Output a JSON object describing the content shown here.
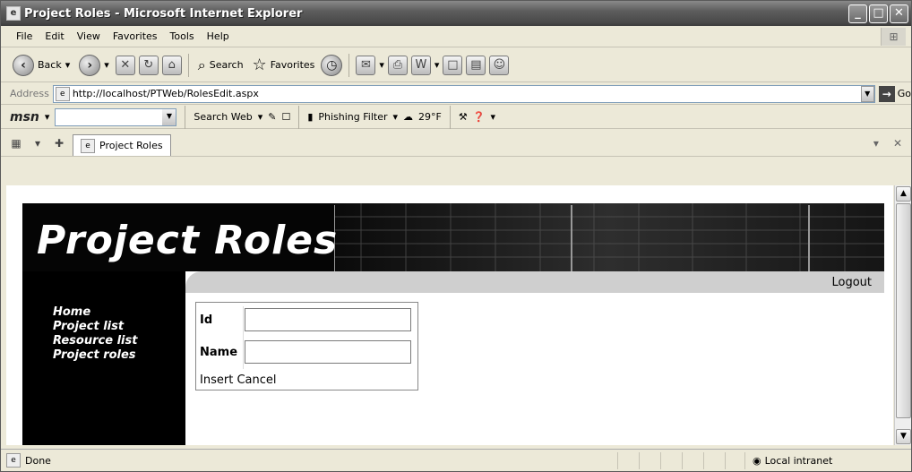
{
  "window": {
    "title": "Project Roles - Microsoft Internet Explorer"
  },
  "menu": [
    "File",
    "Edit",
    "View",
    "Favorites",
    "Tools",
    "Help"
  ],
  "toolbar": {
    "back": "Back",
    "search": "Search",
    "favorites": "Favorites"
  },
  "address": {
    "label": "Address",
    "url": "http://localhost/PTWeb/RolesEdit.aspx",
    "go": "Go"
  },
  "msn": {
    "logo": "msn",
    "search_web": "Search Web",
    "phishing": "Phishing Filter",
    "weather": "29°F"
  },
  "tab": {
    "title": "Project Roles"
  },
  "page": {
    "banner_title": "Project Roles",
    "logout": "Logout",
    "nav": [
      "Home",
      "Project list",
      "Resource list",
      "Project roles"
    ],
    "form": {
      "id_label": "Id",
      "name_label": "Name",
      "insert": "Insert",
      "cancel": "Cancel"
    }
  },
  "status": {
    "text": "Done",
    "zone": "Local intranet"
  }
}
